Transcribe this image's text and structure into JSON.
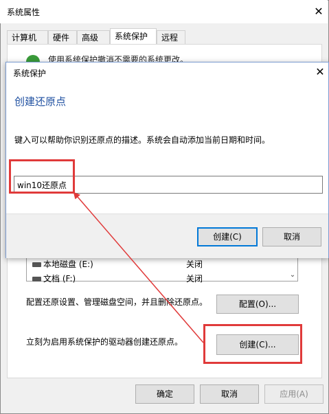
{
  "outer_window": {
    "title": "系统属性",
    "tabs": [
      {
        "label": "计算机名",
        "active": false
      },
      {
        "label": "硬件",
        "active": false
      },
      {
        "label": "高级",
        "active": false
      },
      {
        "label": "系统保护",
        "active": true
      },
      {
        "label": "远程",
        "active": false
      }
    ],
    "description": "使用系统保护撤消不需要的系统更改。",
    "drives": [
      {
        "name": "本地磁盘 (E:)",
        "status": "关闭"
      },
      {
        "name": "文档 (F:)",
        "status": "关闭"
      }
    ],
    "configure_text": "配置还原设置、管理磁盘空间，并且删除还原点。",
    "configure_button": "配置(O)...",
    "create_text": "立刻为启用系统保护的驱动器创建还原点。",
    "create_button": "创建(C)...",
    "ok_button": "确定",
    "cancel_button": "取消",
    "apply_button": "应用(A)"
  },
  "dialog": {
    "title": "系统保护",
    "heading": "创建还原点",
    "instruction": "键入可以帮助你识别还原点的描述。系统会自动添加当前日期和时间。",
    "input_value": "win10还原点",
    "create_button": "创建(C)",
    "cancel_button": "取消"
  },
  "colors": {
    "accent": "#0078d7",
    "heading": "#1e4fa0",
    "annotation_red": "#e03a3a"
  }
}
